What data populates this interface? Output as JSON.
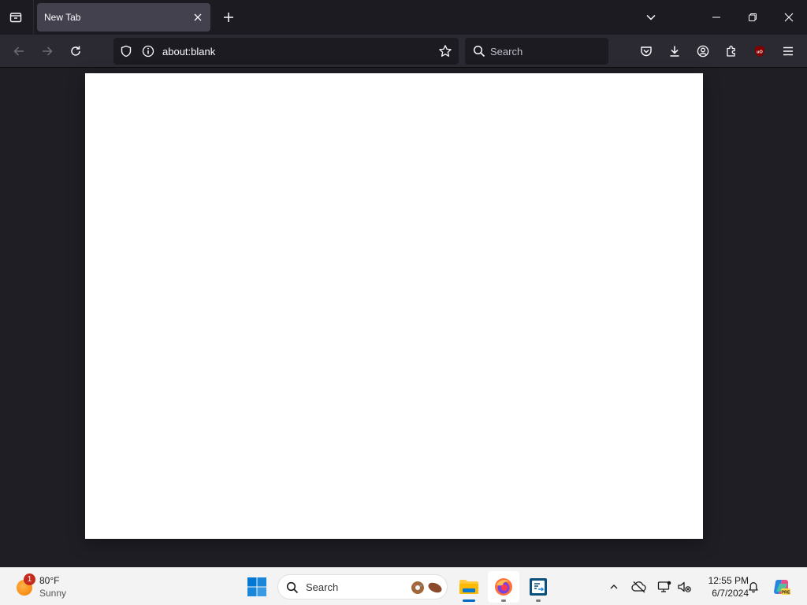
{
  "browser": {
    "tab": {
      "title": "New Tab"
    },
    "urlbar": {
      "url": "about:blank"
    },
    "searchbar": {
      "placeholder": "Search"
    }
  },
  "taskbar": {
    "weather": {
      "temp": "80°F",
      "condition": "Sunny",
      "badge": "1"
    },
    "search": {
      "placeholder": "Search"
    },
    "clock": {
      "time": "12:55 PM",
      "date": "6/7/2024"
    }
  },
  "icons": {
    "tab_list": "tab-list-icon",
    "close": "close-icon",
    "new_tab": "plus-icon",
    "back": "back-arrow-icon",
    "forward": "forward-arrow-icon",
    "reload": "reload-icon",
    "shield": "shield-icon",
    "info": "info-icon",
    "bookmark": "star-icon",
    "pocket": "pocket-icon",
    "downloads": "download-icon",
    "account": "account-icon",
    "extensions": "puzzle-icon",
    "ublock": "ublock-icon",
    "menu": "hamburger-menu-icon"
  },
  "colors": {
    "toolbar": "#2b2a33",
    "tab_active": "#42414d",
    "frame": "#1c1b22",
    "taskbar": "#f3f3f3"
  }
}
